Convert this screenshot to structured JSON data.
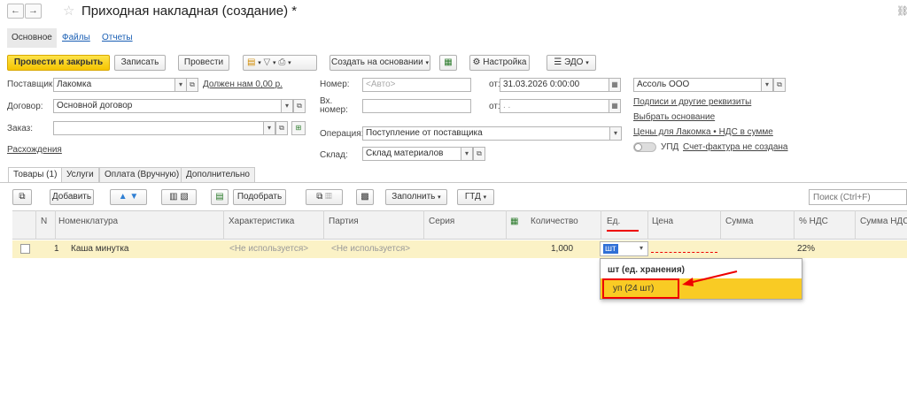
{
  "window": {
    "title": "Приходная накладная (создание) *",
    "back_glyph": "←",
    "forward_glyph": "→",
    "star_glyph": "☆",
    "link_glyph": "🔗"
  },
  "top_tabs": {
    "main": "Основное",
    "files": "Файлы",
    "reports": "Отчеты"
  },
  "toolbar": {
    "post_close": "Провести и закрыть",
    "save": "Записать",
    "post": "Провести",
    "create_based": "Создать на основании",
    "settings": "Настройка",
    "edo": "ЭДО"
  },
  "form": {
    "supplier_label": "Поставщик:",
    "supplier_value": "Лакомка",
    "supplier_debt": "Должен нам 0,00 р.",
    "contract_label": "Договор:",
    "contract_value": "Основной договор",
    "order_label": "Заказ:",
    "order_value": "",
    "discrepancies": "Расхождения",
    "number_label": "Номер:",
    "number_placeholder": "<Авто>",
    "from_label": "от:",
    "date_value": "31.03.2026  0:00:00",
    "in_number_label_1": "Вх.",
    "in_number_label_2": "номер:",
    "in_number_value": "",
    "from_label_2": "от:",
    "in_date_value": " .  .",
    "operation_label": "Операция:",
    "operation_value": "Поступление от поставщика",
    "warehouse_label": "Склад:",
    "warehouse_value": "Склад материалов",
    "organization_value": "Ассоль ООО",
    "signatures_link": "Подписи и другие реквизиты",
    "select_base_link": "Выбрать основание",
    "prices_link": "Цены для Лакомка • НДС в сумме",
    "upd_label": "УПД",
    "invoice_link": "Счет-фактура не создана"
  },
  "sub_tabs": [
    {
      "label": "Товары (1)"
    },
    {
      "label": "Услуги"
    },
    {
      "label": "Оплата (Вручную)"
    },
    {
      "label": "Дополнительно"
    }
  ],
  "table_toolbar": {
    "add": "Добавить",
    "select": "Подобрать",
    "fill": "Заполнить",
    "gtd": "ГТД",
    "search_placeholder": "Поиск (Ctrl+F)"
  },
  "table": {
    "headers": {
      "n": "N",
      "item": "Номенклатура",
      "characteristic": "Характеристика",
      "batch": "Партия",
      "series": "Серия",
      "quantity": "Количество",
      "unit": "Ед.",
      "price": "Цена",
      "sum": "Сумма",
      "vat_rate": "% НДС",
      "vat_sum": "Сумма НДС"
    },
    "rows": [
      {
        "n": "1",
        "item": "Каша минутка",
        "characteristic": "<Не используется>",
        "batch": "<Не используется>",
        "quantity": "1,000",
        "unit": "шт",
        "vat_rate": "22%"
      }
    ]
  },
  "unit_dropdown": {
    "options": [
      "шт (ед. хранения)",
      "уп (24 шт)"
    ],
    "highlighted_index": 1
  },
  "colors": {
    "accent_yellow": "#f5c400",
    "row_highlight": "#fbf2c6",
    "annotation_red": "#e00000",
    "link_blue": "#1a5fb4"
  }
}
